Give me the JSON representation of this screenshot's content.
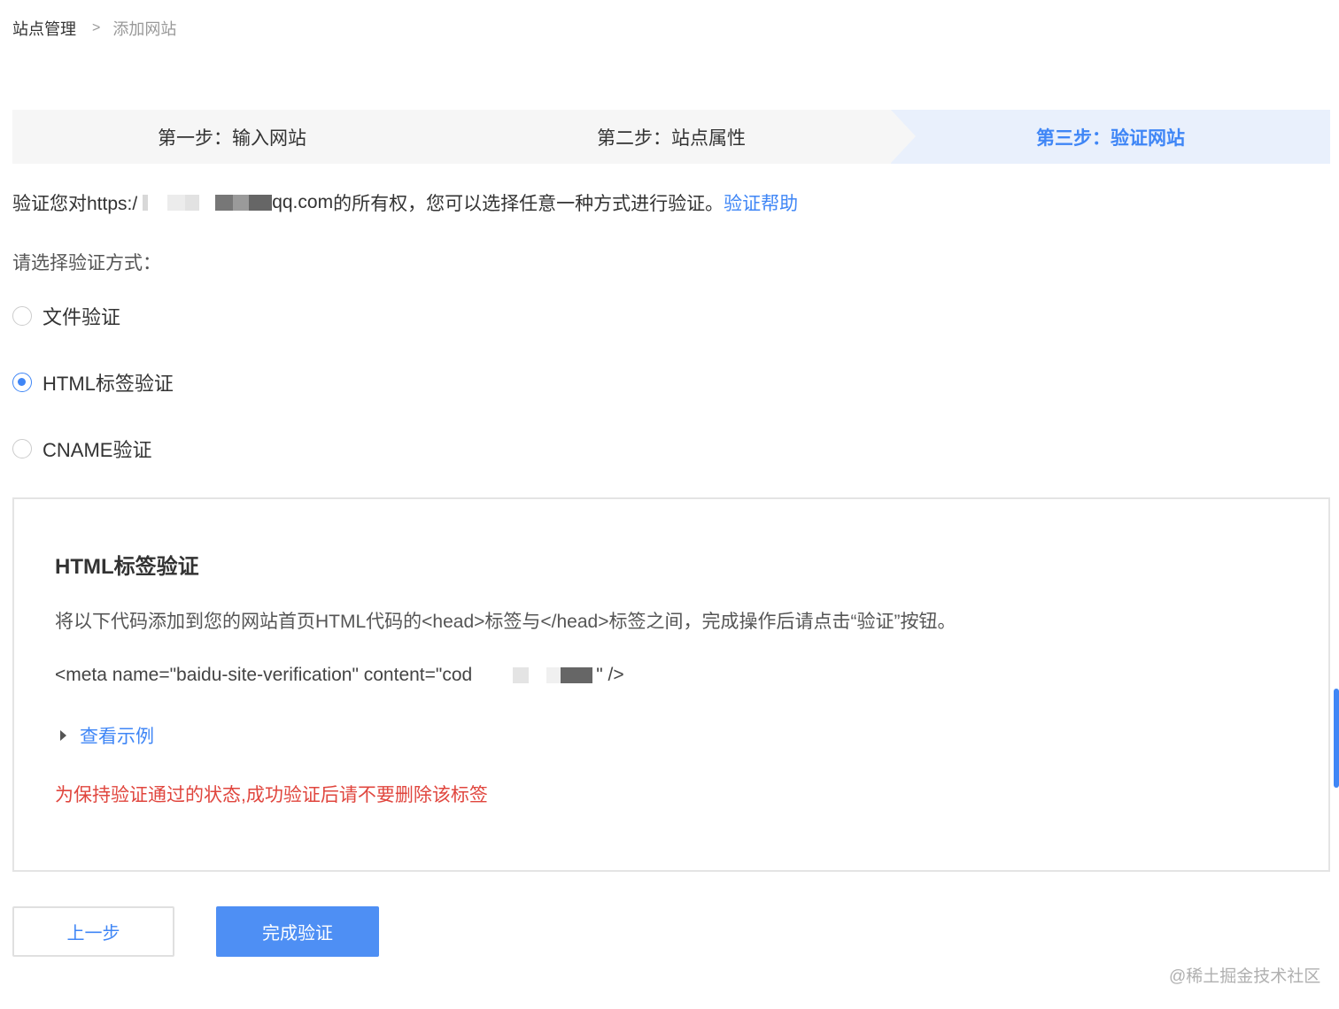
{
  "breadcrumb": {
    "root": "站点管理",
    "separator": ">",
    "current": "添加网站"
  },
  "steps": [
    {
      "label": "第一步：输入网站",
      "state": "done"
    },
    {
      "label": "第二步：站点属性",
      "state": "done"
    },
    {
      "label": "第三步：验证网站",
      "state": "active"
    }
  ],
  "intro": {
    "prefix": "验证您对https:/",
    "domain_suffix": "qq.com",
    "suffix": "的所有权，您可以选择任意一种方式进行验证。",
    "help_link": "验证帮助"
  },
  "choose_label": "请选择验证方式：",
  "methods": [
    {
      "label": "文件验证",
      "checked": false
    },
    {
      "label": "HTML标签验证",
      "checked": true
    },
    {
      "label": "CNAME验证",
      "checked": false
    }
  ],
  "panel": {
    "title": "HTML标签验证",
    "description": "将以下代码添加到您的网站首页HTML代码的<head>标签与</head>标签之间，完成操作后请点击“验证”按钮。",
    "code_prefix": "<meta name=\"baidu-site-verification\" content=\"cod",
    "code_suffix": "\" />",
    "example_label": "查看示例",
    "warning": "为保持验证通过的状态,成功验证后请不要删除该标签"
  },
  "buttons": {
    "prev": "上一步",
    "finish": "完成验证"
  },
  "watermark": "@稀土掘金技术社区",
  "colors": {
    "accent": "#3f86f6",
    "warning": "#e0463e",
    "step_active_bg": "#e9f0fc",
    "step_bg": "#f6f6f6"
  }
}
